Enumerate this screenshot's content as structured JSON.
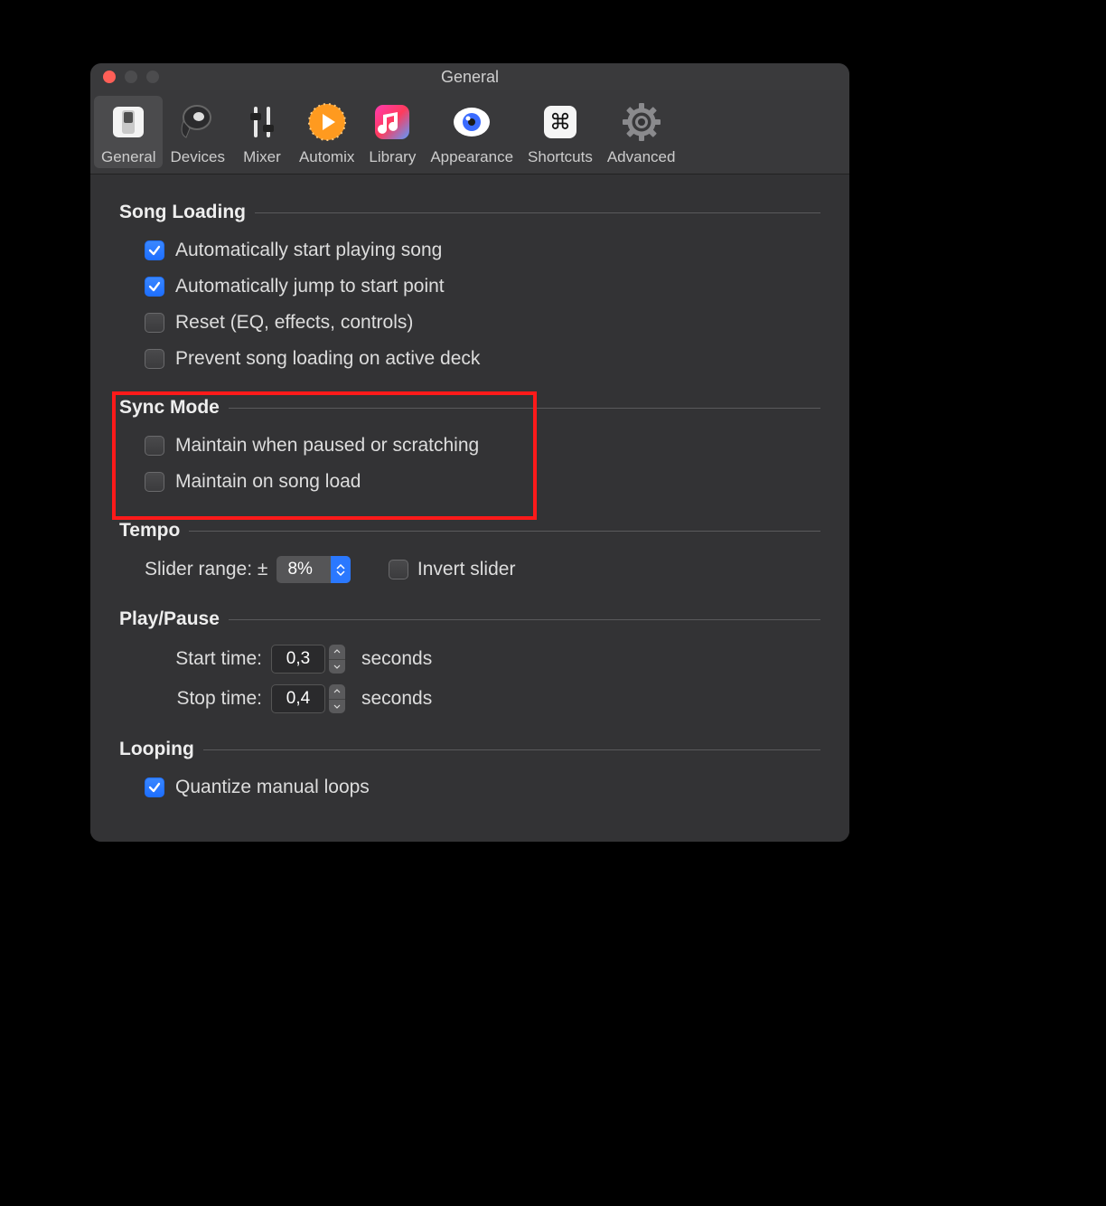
{
  "window": {
    "title": "General"
  },
  "tabs": [
    {
      "label": "General"
    },
    {
      "label": "Devices"
    },
    {
      "label": "Mixer"
    },
    {
      "label": "Automix"
    },
    {
      "label": "Library"
    },
    {
      "label": "Appearance"
    },
    {
      "label": "Shortcuts"
    },
    {
      "label": "Advanced"
    }
  ],
  "sections": {
    "songLoading": {
      "title": "Song Loading",
      "items": [
        {
          "label": "Automatically start playing song"
        },
        {
          "label": "Automatically jump to start point"
        },
        {
          "label": "Reset (EQ, effects, controls)"
        },
        {
          "label": "Prevent song loading on active deck"
        }
      ]
    },
    "syncMode": {
      "title": "Sync Mode",
      "items": [
        {
          "label": "Maintain when paused or scratching"
        },
        {
          "label": "Maintain on song load"
        }
      ]
    },
    "tempo": {
      "title": "Tempo",
      "sliderRangeLabel": "Slider range: ±",
      "sliderRangeValue": "8%",
      "invertLabel": "Invert slider"
    },
    "playPause": {
      "title": "Play/Pause",
      "startLabel": "Start time:",
      "startValue": "0,3",
      "stopLabel": "Stop time:",
      "stopValue": "0,4",
      "unit": "seconds"
    },
    "looping": {
      "title": "Looping",
      "items": [
        {
          "label": "Quantize manual loops"
        }
      ]
    }
  }
}
